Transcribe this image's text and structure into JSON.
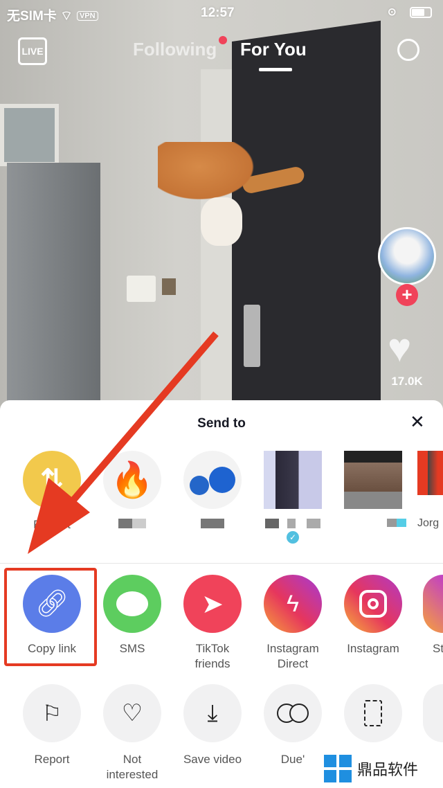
{
  "status_bar": {
    "carrier": "无SIM卡",
    "vpn": "VPN",
    "time": "12:57"
  },
  "top_nav": {
    "live_label": "LIVE",
    "tabs": [
      {
        "label": "Following",
        "active": false,
        "has_dot": true
      },
      {
        "label": "For You",
        "active": true
      }
    ]
  },
  "video": {
    "likes": "17.0K"
  },
  "share_sheet": {
    "title": "Send to",
    "contacts": [
      {
        "label": "Repost"
      },
      {
        "label": ""
      },
      {
        "label": ""
      },
      {
        "label": "",
        "verified": true
      },
      {
        "label": ""
      },
      {
        "label": "Jorg"
      }
    ],
    "share_options": [
      {
        "label": "Copy link",
        "color": "#5b7de8",
        "icon": "link-icon"
      },
      {
        "label": "SMS",
        "color": "#5dcd5f",
        "icon": "chat-bubble-icon"
      },
      {
        "label": "TikTok friends",
        "color": "#f0435a",
        "icon": "send-icon"
      },
      {
        "label": "Instagram Direct",
        "color": "#c13fc5",
        "icon": "messenger-icon"
      },
      {
        "label": "Instagram",
        "color": "#d8388a",
        "icon": "instagram-icon"
      },
      {
        "label": "St",
        "color": "#c13fc5",
        "icon": "stories-icon"
      }
    ],
    "actions": [
      {
        "label": "Report",
        "icon": "flag-icon"
      },
      {
        "label": "Not interested",
        "icon": "broken-heart-icon"
      },
      {
        "label": "Save video",
        "icon": "download-icon"
      },
      {
        "label": "Due'",
        "icon": "duet-icon"
      },
      {
        "label": "",
        "icon": "stitch-icon"
      },
      {
        "label": "",
        "icon": "more-icon"
      }
    ]
  },
  "watermark": {
    "text": "鼎品软件"
  },
  "colors": {
    "annotation_red": "#e53a22",
    "repost_yellow": "#f2c94c"
  }
}
